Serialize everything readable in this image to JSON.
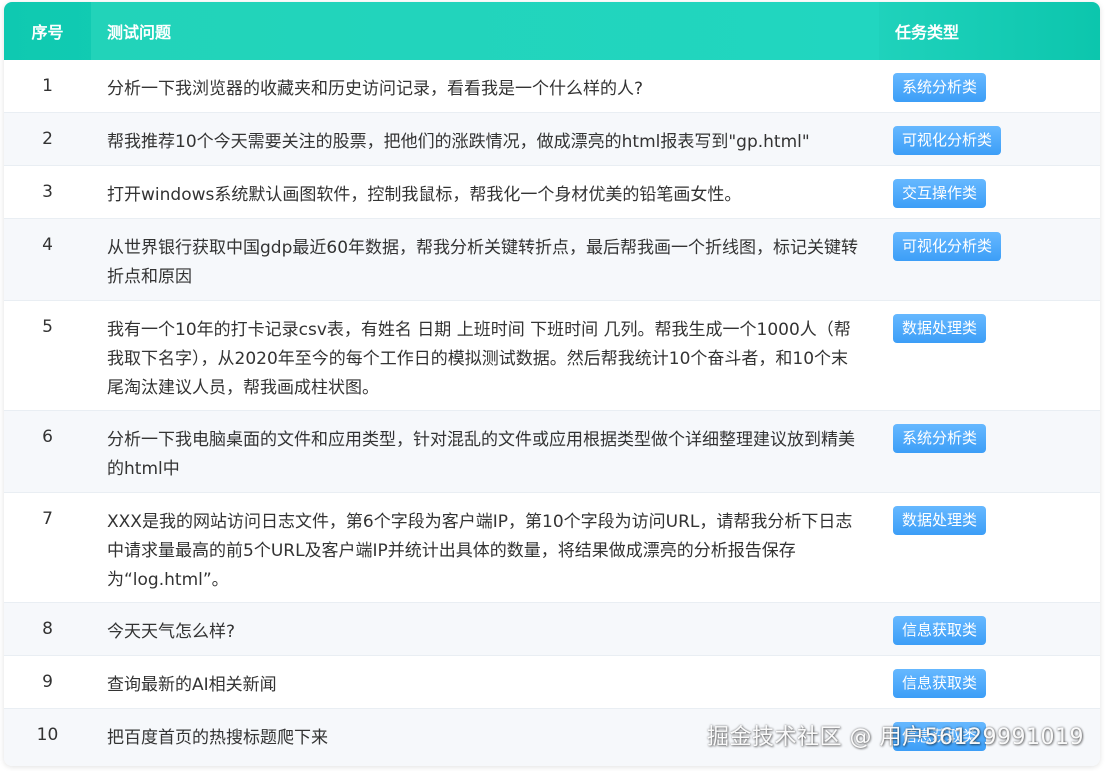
{
  "table": {
    "headers": {
      "num": "序号",
      "question": "测试问题",
      "type": "任务类型"
    },
    "rows": [
      {
        "num": "1",
        "question": "分析一下我浏览器的收藏夹和历史访问记录，看看我是一个什么样的人?",
        "type": "系统分析类"
      },
      {
        "num": "2",
        "question": "帮我推荐10个今天需要关注的股票，把他们的涨跌情况，做成漂亮的html报表写到\"gp.html\"",
        "type": "可视化分析类"
      },
      {
        "num": "3",
        "question": "打开windows系统默认画图软件，控制我鼠标，帮我化一个身材优美的铅笔画女性。",
        "type": "交互操作类"
      },
      {
        "num": "4",
        "question": "从世界银行获取中国gdp最近60年数据，帮我分析关键转折点，最后帮我画一个折线图，标记关键转折点和原因",
        "type": "可视化分析类"
      },
      {
        "num": "5",
        "question": "我有一个10年的打卡记录csv表，有姓名 日期 上班时间 下班时间 几列。帮我生成一个1000人（帮我取下名字），从2020年至今的每个工作日的模拟测试数据。然后帮我统计10个奋斗者，和10个末尾淘汰建议人员，帮我画成柱状图。",
        "type": "数据处理类"
      },
      {
        "num": "6",
        "question": "分析一下我电脑桌面的文件和应用类型，针对混乱的文件或应用根据类型做个详细整理建议放到精美的html中",
        "type": "系统分析类"
      },
      {
        "num": "7",
        "question": "XXX是我的网站访问日志文件，第6个字段为客户端IP，第10个字段为访问URL，请帮我分析下日志中请求量最高的前5个URL及客户端IP并统计出具体的数量，将结果做成漂亮的分析报告保存为“log.html”。",
        "type": "数据处理类"
      },
      {
        "num": "8",
        "question": "今天天气怎么样?",
        "type": "信息获取类"
      },
      {
        "num": "9",
        "question": "查询最新的AI相关新闻",
        "type": "信息获取类"
      },
      {
        "num": "10",
        "question": "把百度首页的热搜标题爬下来",
        "type": "信息获取类"
      }
    ]
  },
  "watermark": "掘金技术社区 @ 用户56129991019",
  "colors": {
    "header_gradient_start": "#0fc9b1",
    "header_gradient_end": "#0cc6ad",
    "badge_color": "#4aa8fa",
    "alt_row_bg": "#f6f8fb"
  }
}
